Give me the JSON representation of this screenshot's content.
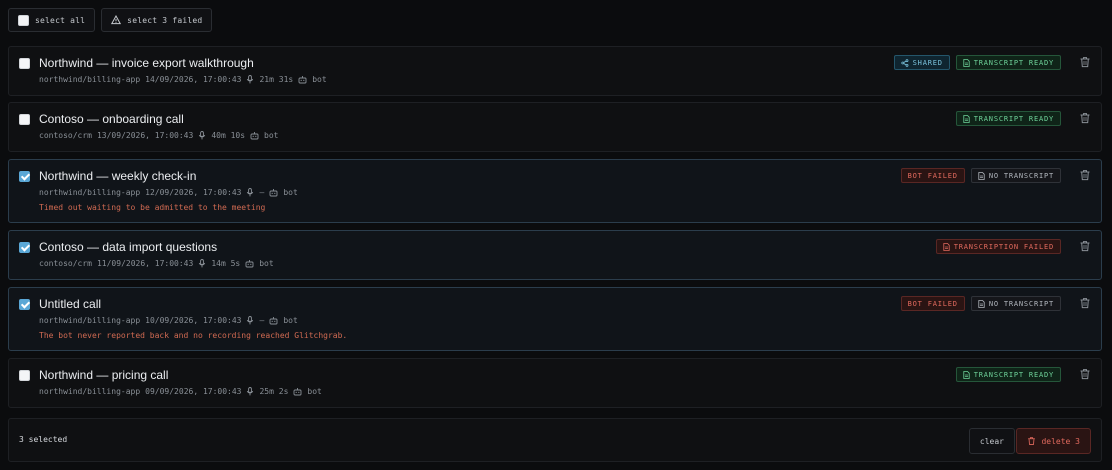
{
  "toolbar": {
    "select_all": "select all",
    "select_failed": "select 3 failed"
  },
  "recordings": [
    {
      "title": "Northwind — invoice export walkthrough",
      "repo": "northwind/billing-app",
      "datetime": "14/09/2026, 17:00:43",
      "duration": "21m 31s",
      "source": "bot",
      "selected": false,
      "badges": [
        "SHARED",
        "TRANSCRIPT READY"
      ]
    },
    {
      "title": "Contoso — onboarding call",
      "repo": "contoso/crm",
      "datetime": "13/09/2026, 17:00:43",
      "duration": "40m 10s",
      "source": "bot",
      "selected": false,
      "badges": [
        "TRANSCRIPT READY"
      ]
    },
    {
      "title": "Northwind — weekly check-in",
      "repo": "northwind/billing-app",
      "datetime": "12/09/2026, 17:00:43",
      "duration": "—",
      "source": "bot",
      "selected": true,
      "badges": [
        "BOT FAILED",
        "NO TRANSCRIPT"
      ],
      "error": "Timed out waiting to be admitted to the meeting"
    },
    {
      "title": "Contoso — data import questions",
      "repo": "contoso/crm",
      "datetime": "11/09/2026, 17:00:43",
      "duration": "14m 5s",
      "source": "bot",
      "selected": true,
      "badges": [
        "TRANSCRIPTION FAILED"
      ]
    },
    {
      "title": "Untitled call",
      "repo": "northwind/billing-app",
      "datetime": "10/09/2026, 17:00:43",
      "duration": "—",
      "source": "bot",
      "selected": true,
      "badges": [
        "BOT FAILED",
        "NO TRANSCRIPT"
      ],
      "error": "The bot never reported back and no recording reached Glitchgrab."
    },
    {
      "title": "Northwind — pricing call",
      "repo": "northwind/billing-app",
      "datetime": "09/09/2026, 17:00:43",
      "duration": "25m 2s",
      "source": "bot",
      "selected": false,
      "badges": [
        "TRANSCRIPT READY"
      ]
    }
  ],
  "footer": {
    "selected_count": "3 selected",
    "clear_label": "clear",
    "delete_label": "delete 3"
  },
  "colors": {
    "accent": "#5aa7d6",
    "success": "#6fd39a",
    "danger": "#e26a5e",
    "shared": "#7cc4de"
  }
}
